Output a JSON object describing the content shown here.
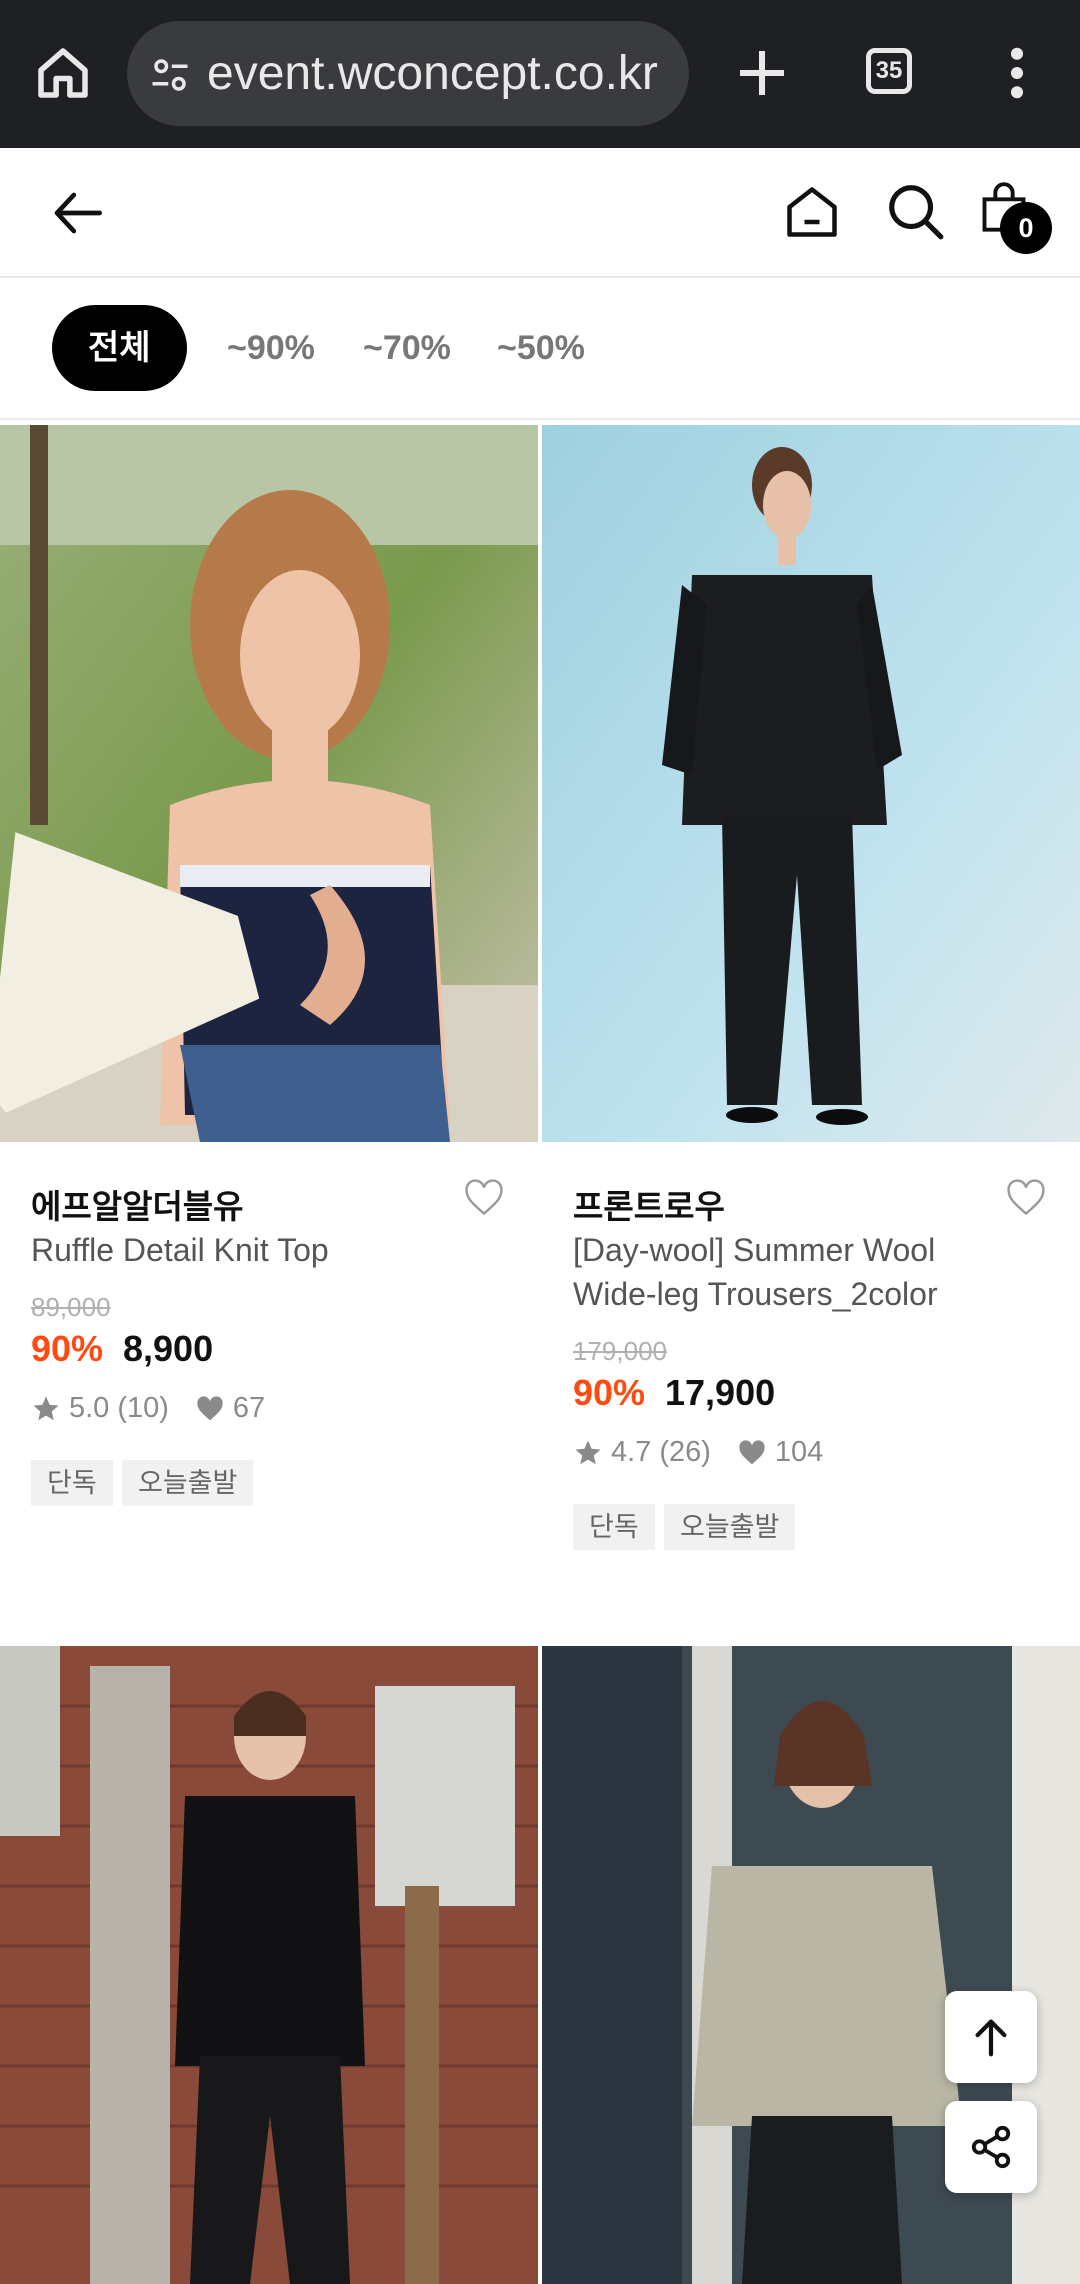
{
  "browser": {
    "url": "event.wconcept.co.kr",
    "tab_count": "35"
  },
  "header": {
    "cart_count": "0"
  },
  "filters": [
    "전체",
    "~90%",
    "~70%",
    "~50%"
  ],
  "products": [
    {
      "brand": "에프알알더블유",
      "name": "Ruffle Detail Knit Top",
      "original_price": "89,000",
      "discount": "90%",
      "price": "8,900",
      "rating": "5.0",
      "reviews": "(10)",
      "likes": "67",
      "tags": [
        "단독",
        "오늘출발"
      ]
    },
    {
      "brand": "프론트로우",
      "name": "[Day-wool] Summer Wool Wide-leg Trousers_2color",
      "original_price": "179,000",
      "discount": "90%",
      "price": "17,900",
      "rating": "4.7",
      "reviews": "(26)",
      "likes": "104",
      "tags": [
        "단독",
        "오늘출발"
      ]
    }
  ],
  "icons": {
    "browser": [
      "home-icon",
      "site-settings-icon",
      "new-tab-icon",
      "tab-switcher-icon",
      "more-vert-icon"
    ],
    "header": [
      "back-arrow-icon",
      "home-icon",
      "search-icon",
      "shopping-bag-icon"
    ],
    "floating": [
      "arrow-up-icon",
      "share-icon"
    ]
  },
  "colors": {
    "discount": "#ff4b12",
    "chip_active_bg": "#000000",
    "browser_bar": "#1f2023"
  }
}
